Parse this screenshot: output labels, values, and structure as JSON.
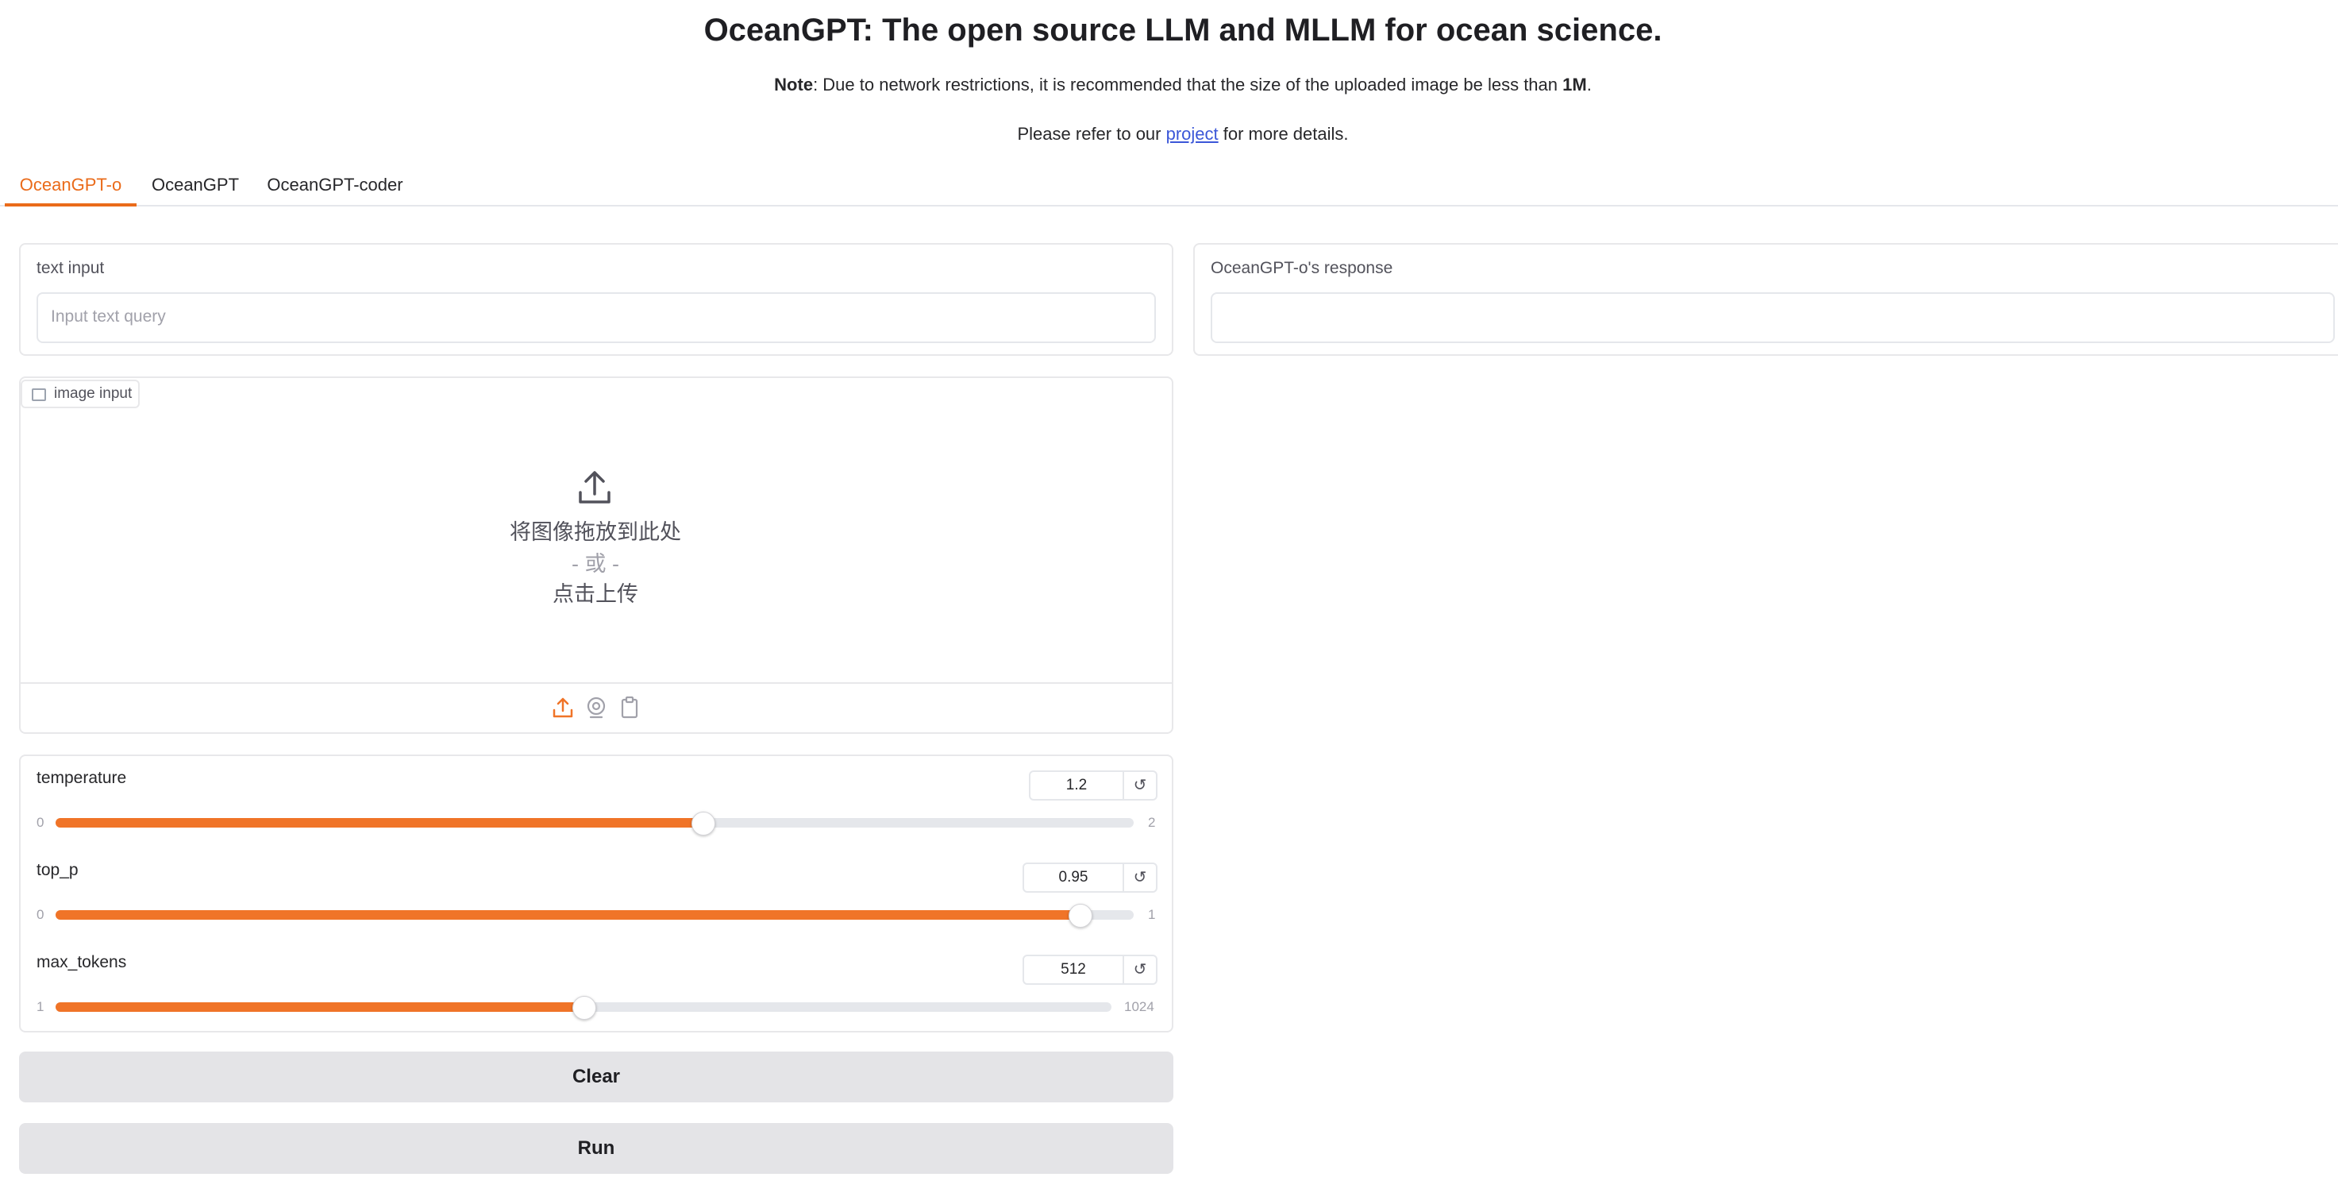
{
  "header": {
    "title": "OceanGPT: The open source LLM and MLLM for ocean science.",
    "note_prefix": "Note",
    "note_text": ": Due to network restrictions, it is recommended that the size of the uploaded image be less than ",
    "note_size": "1M",
    "note_end": ".",
    "refer_prefix": "Please refer to our ",
    "refer_link": "project",
    "refer_suffix": " for more details."
  },
  "tabs": [
    {
      "label": "OceanGPT-o",
      "active": true
    },
    {
      "label": "OceanGPT",
      "active": false
    },
    {
      "label": "OceanGPT-coder",
      "active": false
    }
  ],
  "text_input": {
    "label": "text input",
    "placeholder": "Input text query",
    "value": ""
  },
  "response": {
    "label": "OceanGPT-o's response",
    "value": ""
  },
  "image_input": {
    "label": "image input",
    "drop_text": "将图像拖放到此处",
    "or_text": "- 或 -",
    "click_text": "点击上传",
    "tools": [
      "upload-icon",
      "webcam-icon",
      "clipboard-icon"
    ]
  },
  "sliders": [
    {
      "label": "temperature",
      "value": "1.2",
      "min": "0",
      "max": "2",
      "fraction": 0.6
    },
    {
      "label": "top_p",
      "value": "0.95",
      "min": "0",
      "max": "1",
      "fraction": 0.95
    },
    {
      "label": "max_tokens",
      "value": "512",
      "min": "1",
      "max": "1024",
      "fraction": 0.5
    },
    {
      "reset_glyph": "↺"
    }
  ],
  "buttons": {
    "clear": "Clear",
    "run": "Run"
  },
  "colors": {
    "accent": "#f07428",
    "link": "#3b57d8",
    "button_bg": "#e4e4e7"
  }
}
